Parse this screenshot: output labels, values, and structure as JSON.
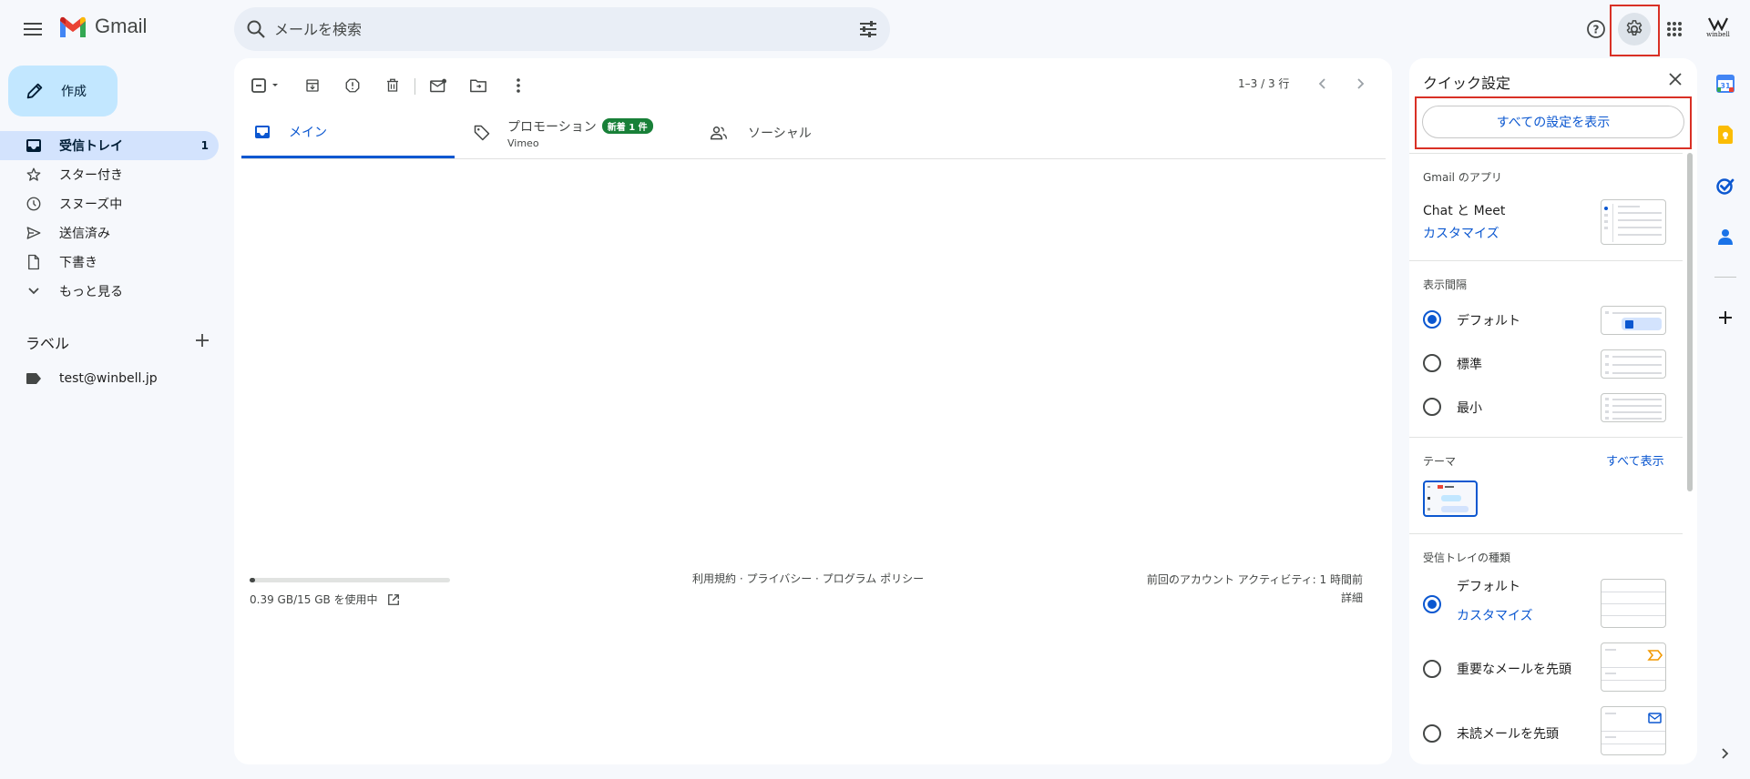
{
  "header": {
    "app_name": "Gmail",
    "search_placeholder": "メールを検索",
    "account_label": "winbell"
  },
  "nav": {
    "compose": "作成",
    "items": [
      {
        "label": "受信トレイ",
        "count": "1",
        "icon": "inbox-icon"
      },
      {
        "label": "スター付き",
        "icon": "star-icon"
      },
      {
        "label": "スヌーズ中",
        "icon": "clock-icon"
      },
      {
        "label": "送信済み",
        "icon": "send-icon"
      },
      {
        "label": "下書き",
        "icon": "draft-icon"
      },
      {
        "label": "もっと見る",
        "icon": "chevron-down-icon"
      }
    ],
    "labels_title": "ラベル",
    "labels": [
      {
        "label": "test@winbell.jp",
        "icon": "label-icon"
      }
    ]
  },
  "main": {
    "page_range": "1–3 / 3 行",
    "tabs": {
      "main": "メイン",
      "promo": "プロモーション",
      "promo_badge": "新着 1 件",
      "promo_sub": "Vimeo",
      "social": "ソーシャル"
    },
    "storage": {
      "text": "0.39 GB/15 GB を使用中",
      "used_fraction": 0.026
    },
    "footer_links": "利用規約 · プライバシー · プログラム ポリシー",
    "activity": "前回のアカウント アクティビティ: 1 時間前",
    "details": "詳細"
  },
  "quick_settings": {
    "title": "クイック設定",
    "all_settings": "すべての設定を表示",
    "apps_section": "Gmail のアプリ",
    "chat_meet": "Chat と Meet",
    "customize": "カスタマイズ",
    "density_section": "表示間隔",
    "density": [
      "デフォルト",
      "標準",
      "最小"
    ],
    "density_selected": 0,
    "theme_section": "テーマ",
    "theme_show_all": "すべて表示",
    "inbox_type_section": "受信トレイの種類",
    "inbox_types": [
      "デフォルト",
      "重要なメールを先頭",
      "未読メールを先頭"
    ],
    "inbox_type_customize": "カスタマイズ",
    "inbox_type_selected": 0
  },
  "colors": {
    "accent": "#0b57d0",
    "compose_bg": "#c2e7ff",
    "active_nav": "#d3e3fd",
    "highlight": "#d93025",
    "badge": "#188038"
  }
}
